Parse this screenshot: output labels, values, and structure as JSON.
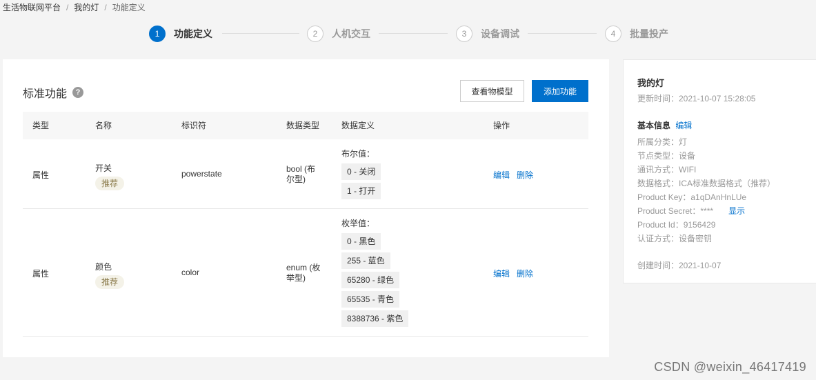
{
  "breadcrumb": {
    "items": [
      "生活物联网平台",
      "我的灯",
      "功能定义"
    ]
  },
  "steps": [
    {
      "num": "1",
      "label": "功能定义",
      "active": true
    },
    {
      "num": "2",
      "label": "人机交互",
      "active": false
    },
    {
      "num": "3",
      "label": "设备调试",
      "active": false
    },
    {
      "num": "4",
      "label": "批量投产",
      "active": false
    }
  ],
  "main": {
    "title": "标准功能",
    "help_glyph": "?",
    "view_model_label": "查看物模型",
    "add_function_label": "添加功能",
    "columns": [
      "类型",
      "名称",
      "标识符",
      "数据类型",
      "数据定义",
      "操作"
    ],
    "rows": [
      {
        "type": "属性",
        "name": "开关",
        "tag": "推荐",
        "identifier": "powerstate",
        "data_type": "bool (布尔型)",
        "def_title": "布尔值：",
        "def_items": [
          "0 - 关闭",
          "1 - 打开"
        ],
        "edit": "编辑",
        "delete": "删除"
      },
      {
        "type": "属性",
        "name": "颜色",
        "tag": "推荐",
        "identifier": "color",
        "data_type": "enum (枚举型)",
        "def_title": "枚举值：",
        "def_items": [
          "0 - 黑色",
          "255 - 蓝色",
          "65280 - 绿色",
          "65535 - 青色",
          "8388736 - 紫色"
        ],
        "edit": "编辑",
        "delete": "删除"
      }
    ]
  },
  "side": {
    "name": "我的灯",
    "updated": "更新时间：2021-10-07 15:28:05",
    "basic_info": "基本信息",
    "edit": "编辑",
    "category": "所属分类：灯",
    "node_type": "节点类型：设备",
    "comm": "通讯方式：WIFI",
    "format": "数据格式：ICA标准数据格式（推荐）",
    "product_key": "Product Key：a1qDAnHnLUe",
    "product_secret": "Product Secret：****",
    "show": "显示",
    "product_id": "Product Id：9156429",
    "auth": "认证方式：设备密钥",
    "created": "创建时间：2021-10-07"
  },
  "watermark": "CSDN @weixin_46417419",
  "colors": {
    "primary": "#0070cc",
    "tag_bg": "#f4f2e8"
  }
}
